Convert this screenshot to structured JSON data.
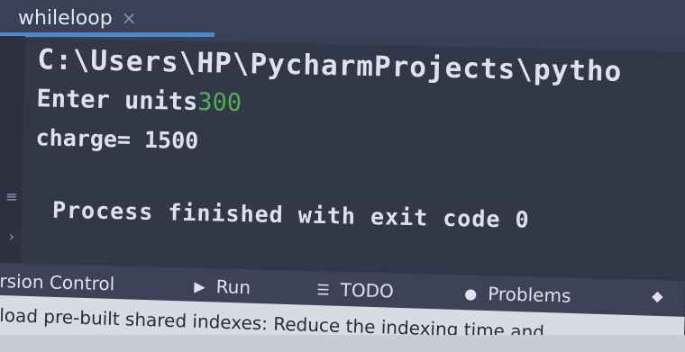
{
  "editor_tab": {
    "title": "whileloop",
    "close_icon": "close-icon"
  },
  "console": {
    "path_line": "C:\\Users\\HP\\PycharmProjects\\pytho",
    "prompt_text": "Enter units",
    "prompt_input": "300",
    "output_line": "charge= 1500",
    "exit_line": "Process finished with exit code 0"
  },
  "tool_windows": {
    "version_control": "rsion Control",
    "run": "Run",
    "todo": "TODO",
    "problems": "Problems",
    "run_icon": "play-icon",
    "todo_icon": "list-icon",
    "problems_icon": "problems-icon",
    "layers_icon": "layers-icon"
  },
  "status_bar": {
    "message": "load pre-built shared indexes: Reduce the indexing time and"
  },
  "colors": {
    "console_bg": "#333849",
    "input_text": "#4fb04f",
    "tab_accent": "#4a88c7"
  }
}
